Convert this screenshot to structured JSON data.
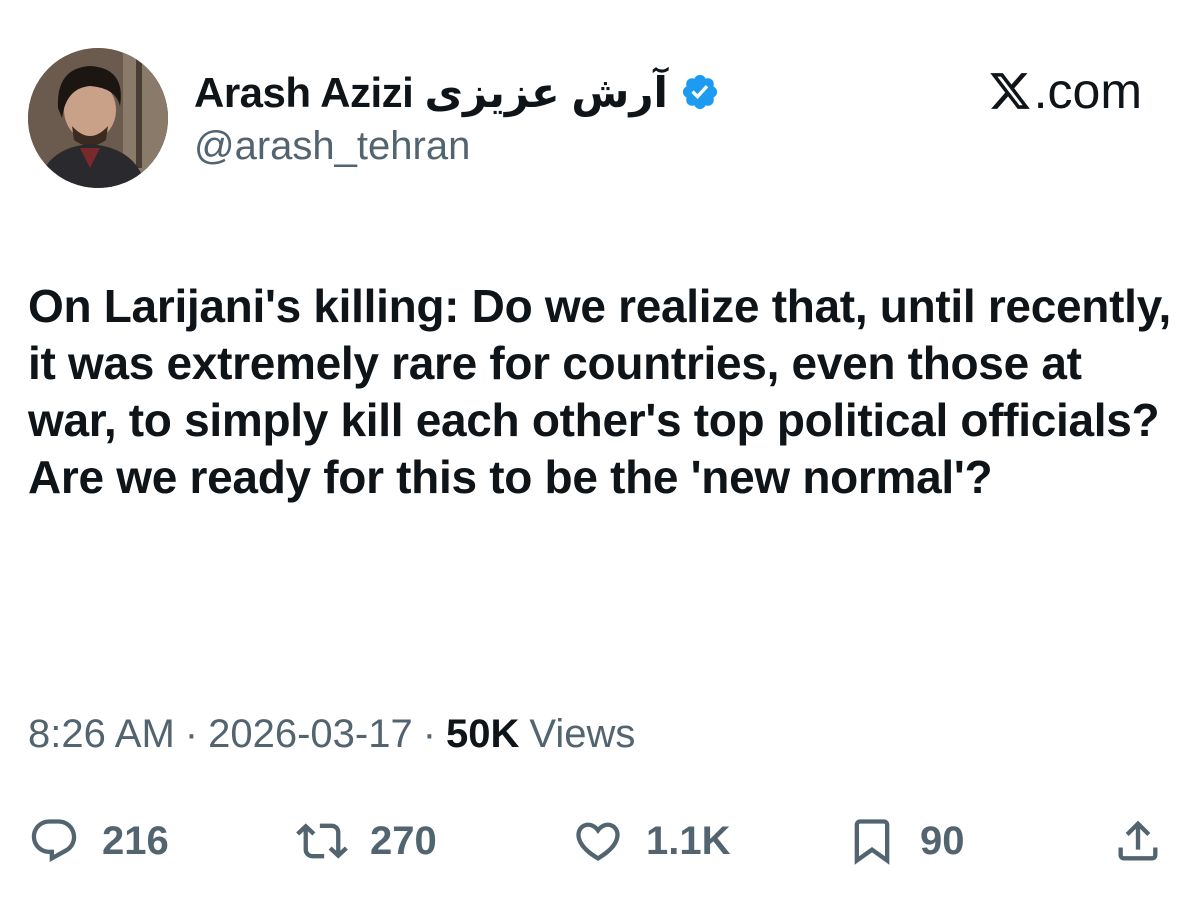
{
  "author": {
    "display_name": "Arash Azizi آرش عزیزی",
    "handle": "@arash_tehran",
    "verified": true
  },
  "site": {
    "label": ".com",
    "logo_icon": "x-logo-icon"
  },
  "tweet": {
    "text": "On Larijani's killing: Do we realize that, until recently, it was extremely rare for countries, even those at war, to simply kill each other's top political officials? Are we ready for this to be the 'new normal'?"
  },
  "meta": {
    "time": "8:26 AM",
    "date": "2026-03-17",
    "views_count": "50K",
    "views_label": "Views",
    "separator": "·"
  },
  "actions": {
    "reply": {
      "icon": "reply-icon",
      "count": "216"
    },
    "retweet": {
      "icon": "retweet-icon",
      "count": "270"
    },
    "like": {
      "icon": "heart-icon",
      "count": "1.1K"
    },
    "bookmark": {
      "icon": "bookmark-icon",
      "count": "90"
    },
    "share": {
      "icon": "share-icon"
    }
  },
  "colors": {
    "text_primary": "#0f1419",
    "text_secondary": "#536471",
    "verified_blue": "#1d9bf0",
    "background": "#ffffff"
  }
}
